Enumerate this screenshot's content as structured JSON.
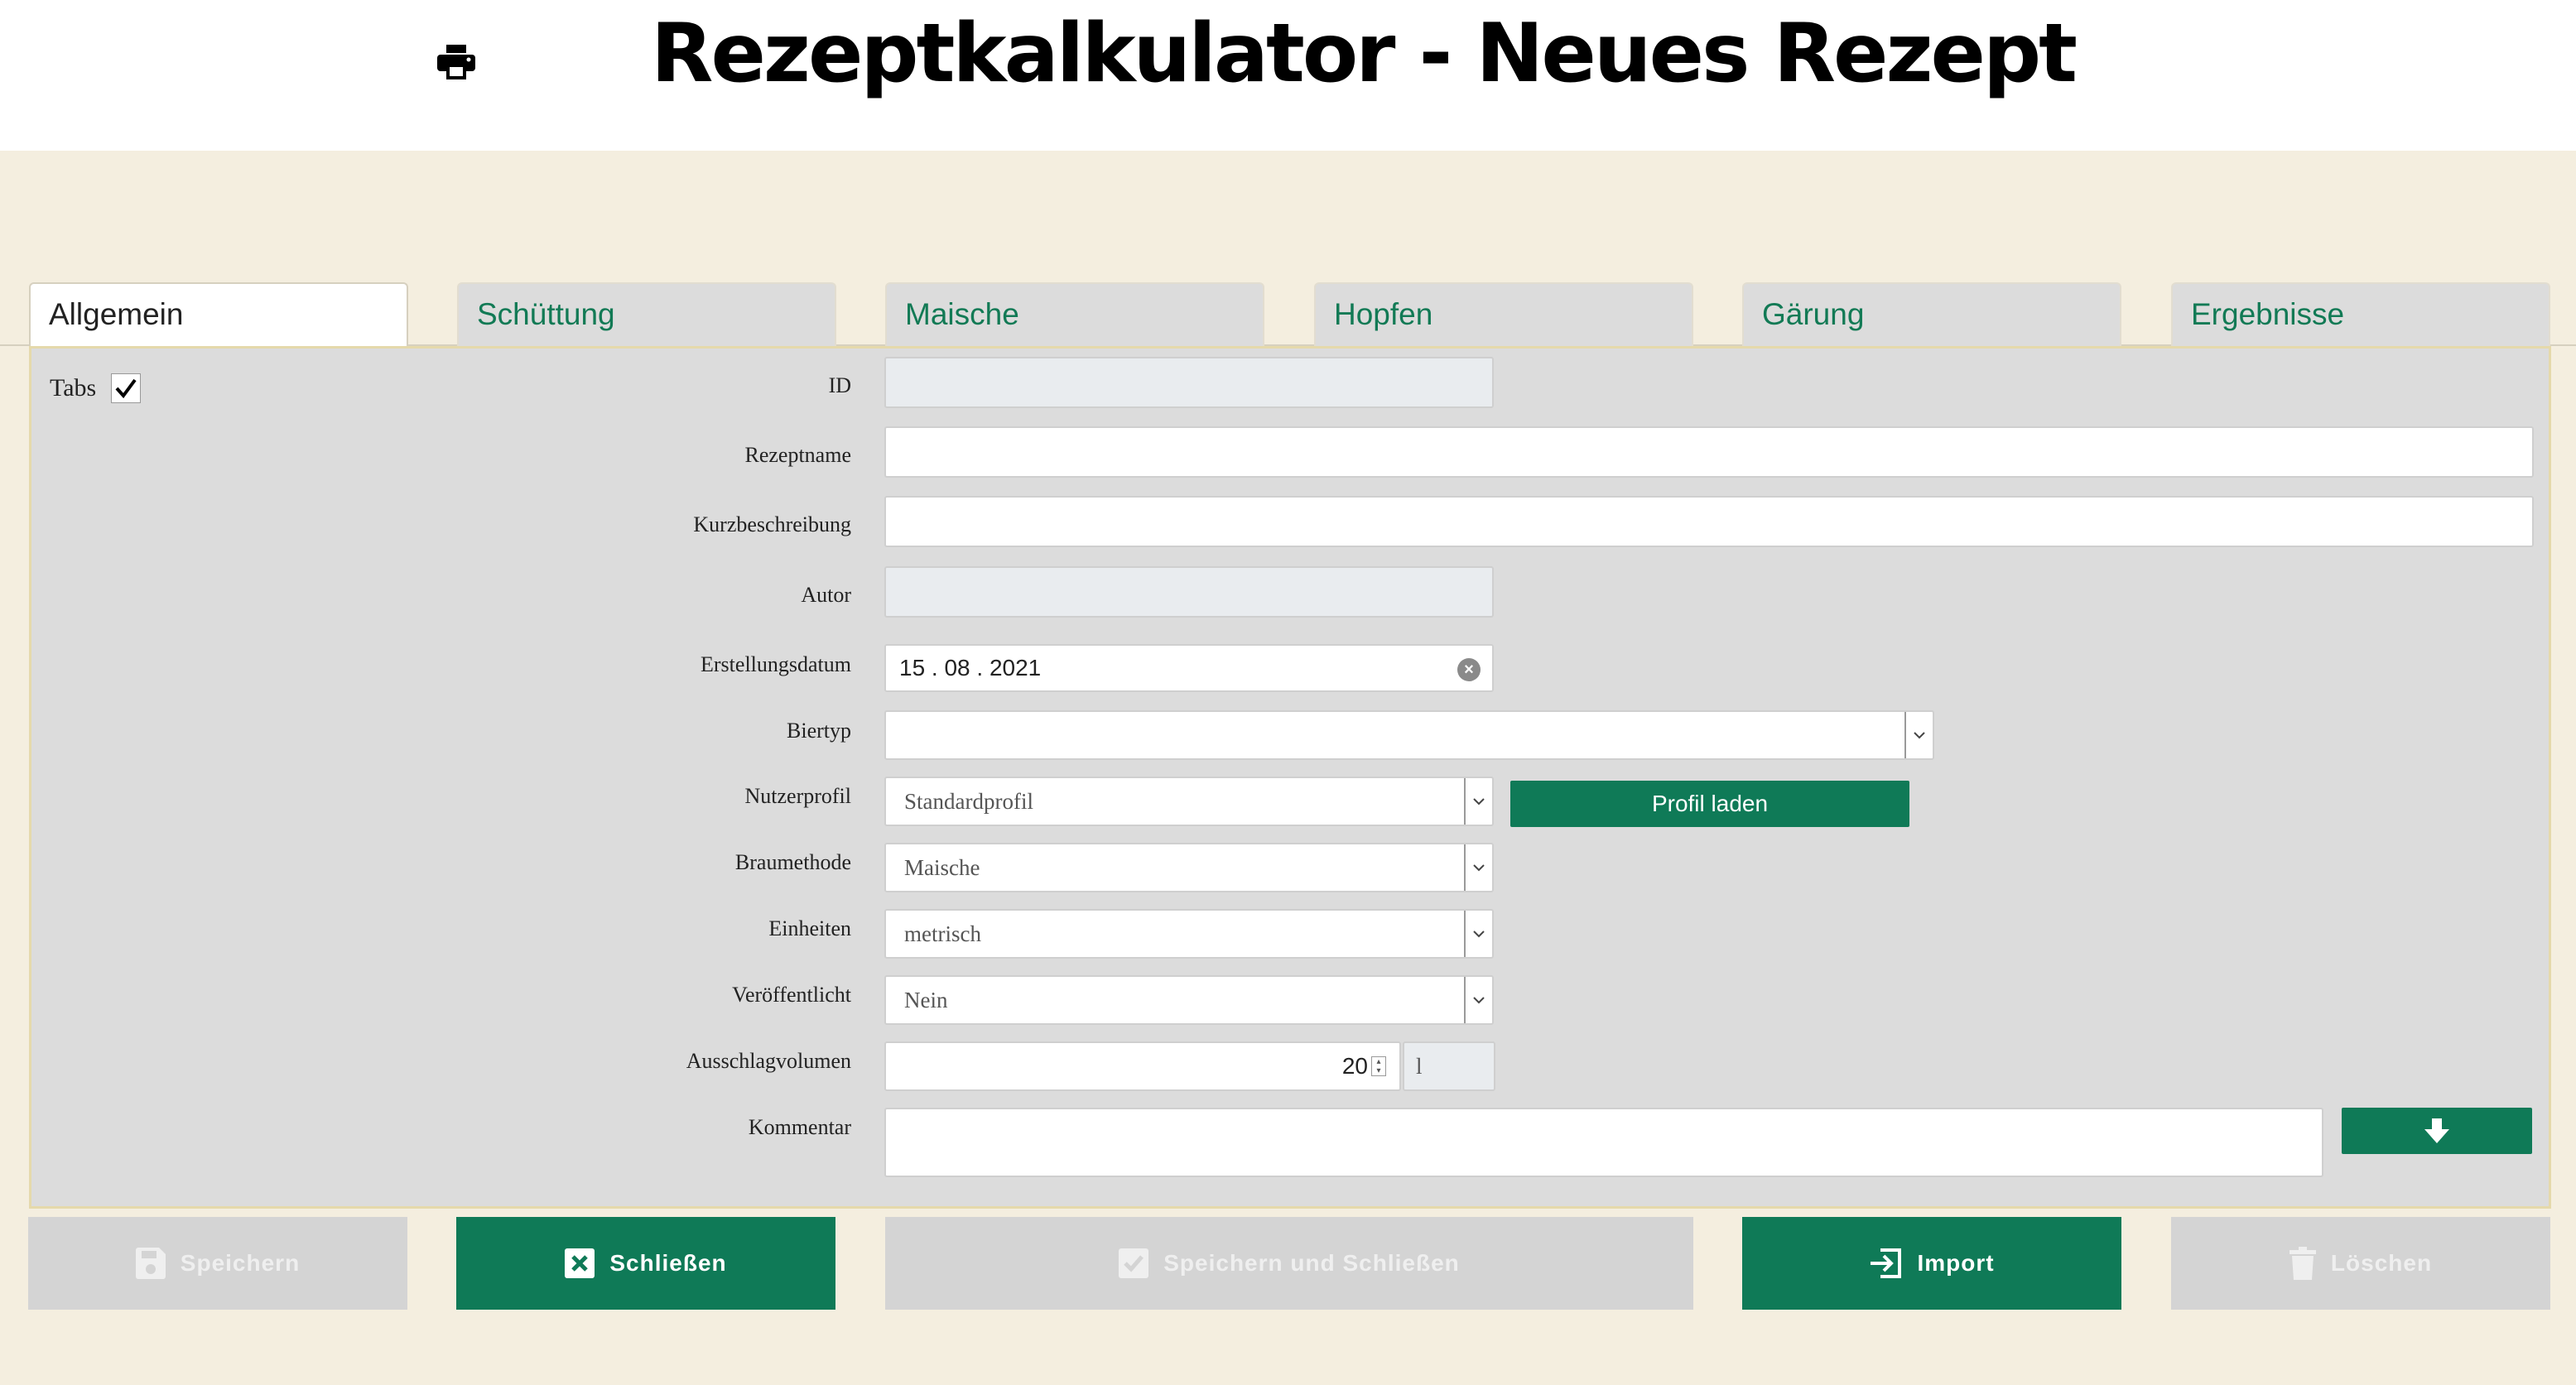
{
  "header": {
    "title": "Rezeptkalkulator - Neues Rezept",
    "print_icon": "printer-icon"
  },
  "tabs": [
    {
      "label": "Allgemein",
      "active": true
    },
    {
      "label": "Schüttung",
      "active": false
    },
    {
      "label": "Maische",
      "active": false
    },
    {
      "label": "Hopfen",
      "active": false
    },
    {
      "label": "Gärung",
      "active": false
    },
    {
      "label": "Ergebnisse",
      "active": false
    }
  ],
  "form": {
    "tabs_checkbox_label": "Tabs",
    "id_label": "ID",
    "id_value": "",
    "rezeptname_label": "Rezeptname",
    "rezeptname_value": "",
    "kurzbeschreibung_label": "Kurzbeschreibung",
    "kurzbeschreibung_value": "",
    "autor_label": "Autor",
    "autor_value": "",
    "erstellungsdatum_label": "Erstellungsdatum",
    "erstellungsdatum_value": "15 . 08 . 2021",
    "biertyp_label": "Biertyp",
    "biertyp_value": "",
    "nutzerprofil_label": "Nutzerprofil",
    "nutzerprofil_value": "Standardprofil",
    "profil_laden_label": "Profil laden",
    "braumethode_label": "Braumethode",
    "braumethode_value": "Maische",
    "einheiten_label": "Einheiten",
    "einheiten_value": "metrisch",
    "veroeffentlicht_label": "Veröffentlicht",
    "veroeffentlicht_value": "Nein",
    "ausschlagvolumen_label": "Ausschlagvolumen",
    "ausschlagvolumen_value": "20",
    "ausschlagvolumen_unit": "l",
    "kommentar_label": "Kommentar",
    "kommentar_value": ""
  },
  "actions": {
    "speichern": "Speichern",
    "schliessen": "Schließen",
    "speichern_schliessen": "Speichern und Schließen",
    "import": "Import",
    "loeschen": "Löschen"
  },
  "colors": {
    "accent": "#0f7a57",
    "background": "#f4eedf",
    "panel": "#dcdcdc",
    "disabled": "#d4d4d4"
  }
}
